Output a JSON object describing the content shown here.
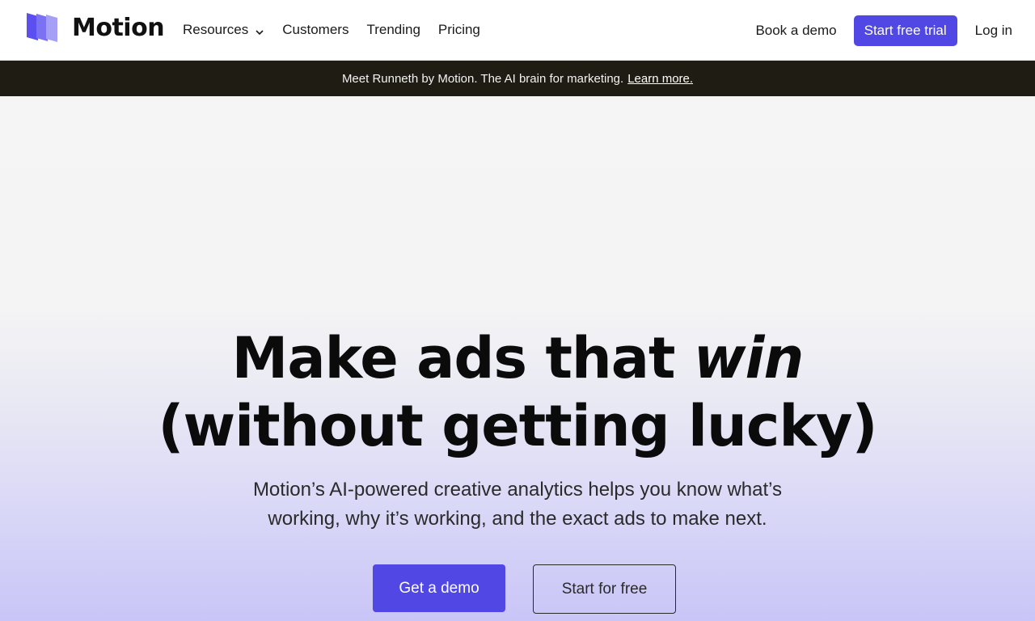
{
  "brand": {
    "name": "Motion",
    "logo_icon": "stacked-pages-logo-icon",
    "accent_color": "#5047e5"
  },
  "nav": {
    "links": [
      {
        "label": "Resources",
        "has_dropdown": true
      },
      {
        "label": "Customers"
      },
      {
        "label": "Trending"
      },
      {
        "label": "Pricing"
      }
    ],
    "book_demo": "Book a demo",
    "start_trial": "Start free trial",
    "login": "Log in"
  },
  "banner": {
    "text": "Meet Runneth by Motion. The AI brain for marketing.",
    "link": "Learn more.",
    "background": "#1f1c14"
  },
  "hero": {
    "headline_line1_prefix": "Make ads that ",
    "headline_line1_emphasis": "win",
    "headline_line2": "(without getting lucky)",
    "subhead_line1": "Motion’s AI-powered creative analytics helps you know what’s",
    "subhead_line2": "working, why it’s working, and the exact ads to make next.",
    "primary_cta": "Get a demo",
    "secondary_cta": "Start for free"
  }
}
